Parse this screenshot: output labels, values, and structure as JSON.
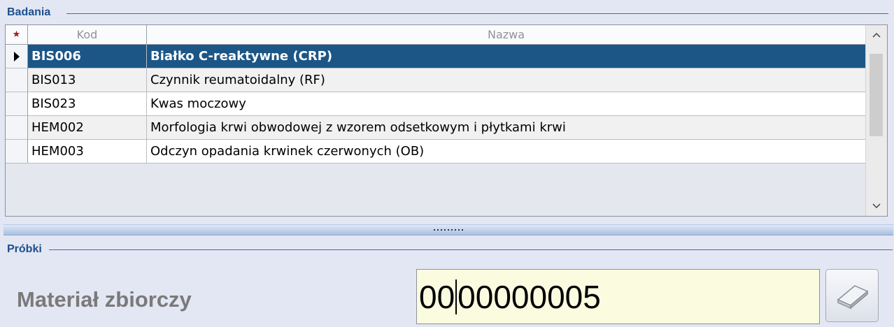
{
  "badania": {
    "title": "Badania",
    "columns": {
      "marker": "★",
      "kod": "Kod",
      "nazwa": "Nazwa"
    },
    "rows": [
      {
        "kod": "BIS006",
        "nazwa": "Białko C-reaktywne (CRP)",
        "selected": true
      },
      {
        "kod": "BIS013",
        "nazwa": "Czynnik reumatoidalny (RF)"
      },
      {
        "kod": "BIS023",
        "nazwa": "Kwas moczowy"
      },
      {
        "kod": "HEM002",
        "nazwa": "Morfologia krwi obwodowej z wzorem odsetkowym i płytkami krwi"
      },
      {
        "kod": "HEM003",
        "nazwa": "Odczyn opadania krwinek czerwonych (OB)"
      }
    ]
  },
  "probki": {
    "title": "Próbki",
    "material_label": "Materiał zbiorczy",
    "code_before_caret": "00",
    "code_after_caret": "00000005"
  },
  "icons": {
    "current_row": "row-pointer-icon",
    "scroll_up": "chevron-up-icon",
    "scroll_down": "chevron-down-icon",
    "clear": "eraser-icon"
  },
  "colors": {
    "selected_row": "#1b5687",
    "group_title": "#1c4f8c",
    "input_background": "#fafbdf"
  }
}
